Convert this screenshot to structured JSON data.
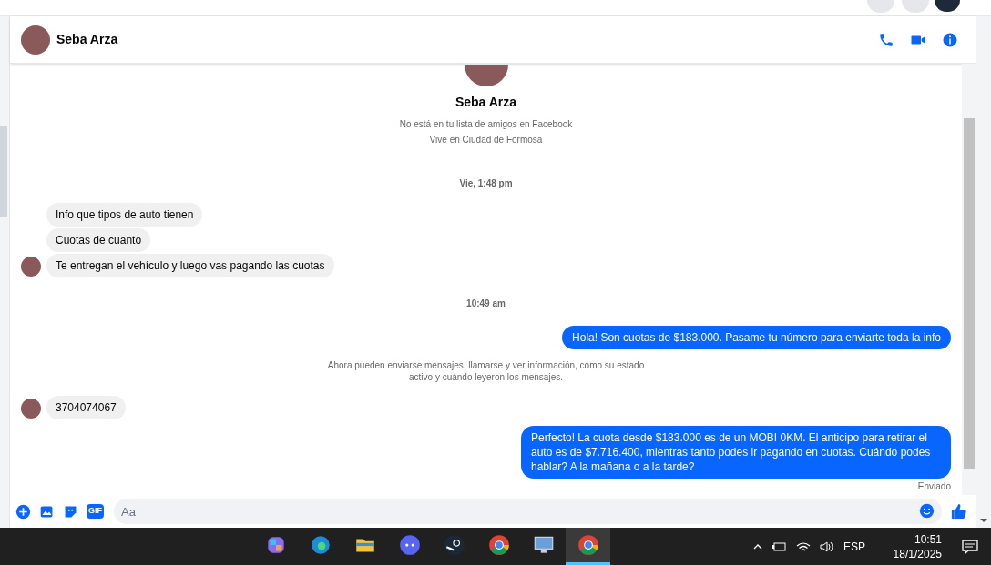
{
  "chat_header": {
    "name": "Seba Arza"
  },
  "profile": {
    "name": "Seba Arza",
    "lines": [
      "No está en tu lista de amigos en Facebook",
      "Vive en Ciudad de Formosa"
    ]
  },
  "messages": [
    {
      "kind": "timestamp",
      "text": "Vie, 1:48 pm"
    },
    {
      "kind": "incoming",
      "text": "Info que tipos de auto tienen",
      "show_avatar": false
    },
    {
      "kind": "incoming",
      "text": "Cuotas de cuanto",
      "show_avatar": false
    },
    {
      "kind": "incoming",
      "text": "Te entregan el vehículo y luego vas pagando las cuotas",
      "show_avatar": true
    },
    {
      "kind": "timestamp",
      "text": "10:49 am"
    },
    {
      "kind": "outgoing",
      "text": "Hola! Son cuotas de $183.000. Pasame tu número para enviarte toda la info"
    },
    {
      "kind": "notice",
      "text": "Ahora pueden enviarse mensajes, llamarse y ver información, como su estado activo y cuándo leyeron los mensajes."
    },
    {
      "kind": "incoming",
      "text": "3704074067",
      "show_avatar": true
    },
    {
      "kind": "outgoing",
      "text": "Perfecto! La cuota desde $183.000 es de un MOBI 0KM. El anticipo para retirar el auto es de $7.716.400, mientras tanto podes ir pagando en cuotas. Cuándo podes hablar? A la mañana o a la tarde?"
    },
    {
      "kind": "status",
      "text": "Enviado"
    }
  ],
  "composer": {
    "gif_label": "GIF",
    "placeholder": "Aa"
  },
  "taskbar": {
    "apps": [
      {
        "kind": "copilot",
        "selected": false
      },
      {
        "kind": "edge",
        "selected": false
      },
      {
        "kind": "folder",
        "selected": false
      },
      {
        "kind": "discord",
        "selected": false
      },
      {
        "kind": "steam",
        "selected": false
      },
      {
        "kind": "chrome",
        "selected": false
      },
      {
        "kind": "monitor",
        "selected": false
      },
      {
        "kind": "chrome",
        "selected": true
      }
    ],
    "language": "ESP",
    "time": "10:51",
    "date": "18/1/2025"
  }
}
